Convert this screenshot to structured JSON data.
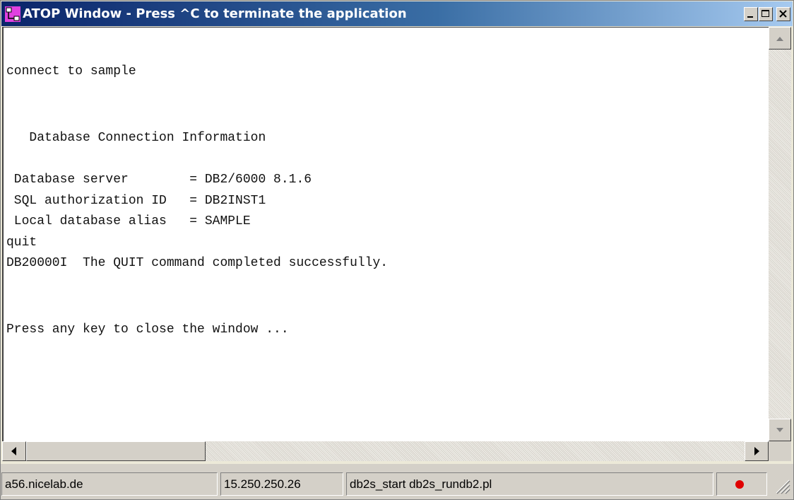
{
  "window": {
    "title": "ATOP Window - Press ^C to terminate the application",
    "title_bg": "#0a246a",
    "controls": [
      "minimize-icon",
      "maximize-icon",
      "close-icon"
    ]
  },
  "console": {
    "lines": [
      "connect to sample",
      "",
      "",
      "   Database Connection Information",
      "",
      " Database server        = DB2/6000 8.1.6",
      " SQL authorization ID   = DB2INST1",
      " Local database alias   = SAMPLE",
      "quit",
      "DB20000I  The QUIT command completed successfully.",
      "",
      "",
      "Press any key to close the window ..."
    ]
  },
  "status": {
    "host": "a56.nicelab.de",
    "ip": "15.250.250.26",
    "command": "db2s_start db2s_rundb2.pl",
    "indicator_color": "#e00000"
  }
}
